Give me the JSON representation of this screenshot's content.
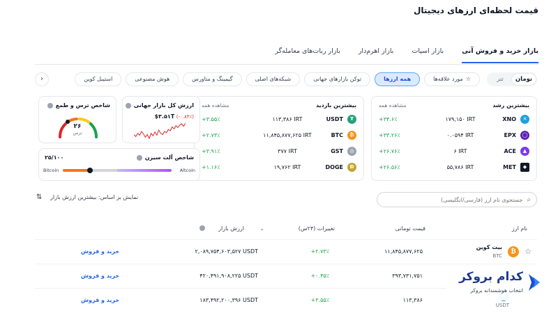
{
  "page_title": "قیمت لحظه‌ای ارزهای دیجیتال",
  "tabs": [
    {
      "label": "بازار خرید و فروش آنی"
    },
    {
      "label": "بازار اسپات"
    },
    {
      "label": "بازار اهرم‌دار"
    },
    {
      "label": "بازار ربات‌های معامله‌گر"
    }
  ],
  "currency_toggle": {
    "toman": "تومان",
    "tether": "تتر"
  },
  "filters": [
    {
      "label": "مورد علاقه‌ها"
    },
    {
      "label": "همه ارزها"
    },
    {
      "label": "توکن بازارهای جهانی"
    },
    {
      "label": "شبکه‌های اصلی"
    },
    {
      "label": "گیمینگ و متاورس"
    },
    {
      "label": "هوش مصنوعی"
    },
    {
      "label": "استیبل کوین"
    }
  ],
  "chevron": "›",
  "top_growth": {
    "title": "بیشترین رشد",
    "more": "مشاهده همه",
    "rows": [
      {
        "symbol": "XNO",
        "price": "۱۷۹,۱۵۰ IRT",
        "change": "+۳۴.۶٪",
        "color": "#1f9fe0"
      },
      {
        "symbol": "EPX",
        "price": "۰.۰۵۹۴ IRT",
        "change": "+۳۳.۲۶٪",
        "color": "#5b21b6"
      },
      {
        "symbol": "ACE",
        "price": "۶ IRT",
        "change": "+۲۶.۷۶٪",
        "color": "#7c3aed"
      },
      {
        "symbol": "MET",
        "price": "۵۵,۷۸۶ IRT",
        "change": "+۲۶.۵۶٪",
        "color": "#111827"
      }
    ]
  },
  "top_visited": {
    "title": "بیشترین بازدید",
    "more": "مشاهده همه",
    "rows": [
      {
        "symbol": "USDT",
        "price": "۱۱۳,۳۸۶ IRT",
        "change": "+۳.۵۵٪",
        "color": "#26a17b"
      },
      {
        "symbol": "BTC",
        "price": "۱۱,۸۴۵,۸۷۷,۶۲۵ IRT",
        "change": "+۲.۷۳٪",
        "color": "#f7931a"
      },
      {
        "symbol": "GST",
        "price": "۳۷۷ IRT",
        "change": "+۳.۹۱٪",
        "color": "#6b7280"
      },
      {
        "symbol": "DOGE",
        "price": "۱۹,۷۶۲ IRT",
        "change": "+۱.۱۶٪",
        "color": "#c2a633"
      }
    ]
  },
  "market_cap": {
    "title": "ارزش کل بازار جهانی",
    "value": "$۳.۵۱T",
    "change": "(-۰.۸۳٪)",
    "sparkline": [
      58,
      55,
      60,
      57,
      63,
      59,
      54,
      58,
      52,
      60,
      56,
      62,
      57,
      65,
      60,
      58,
      63,
      61,
      66,
      64,
      70,
      67,
      72,
      69,
      73,
      75,
      71,
      76
    ]
  },
  "fear_greed": {
    "title": "شاخص ترس و طمع",
    "value": "۲۶",
    "label": "ترس",
    "level": 26
  },
  "altseason": {
    "title": "شاخص آلت سیزن",
    "value": "۲۵/۱۰۰",
    "left": "Bitcoin",
    "right": "Altcoin",
    "level": 25
  },
  "search": {
    "placeholder": "جستجوی نام ارز (فارسی/انگلیسی)"
  },
  "sort": {
    "label": "نمایش بر اساس:  بیشترین ارزش بازار"
  },
  "table": {
    "headers": {
      "name": "نام ارز",
      "price": "قیمت تومانی",
      "change": "تغییرات (۲۴س)",
      "cap": "ارزش بازار"
    },
    "rows": [
      {
        "name": "بیت کوین",
        "symbol": "BTC",
        "price": "۱۱,۸۴۵,۸۷۷,۶۲۵",
        "change": "+۲.۷۳٪",
        "cap": "۲,۰۸۹,۷۵۴,۶۰۳,۵۲۷ USDT",
        "action": "خرید و فروش",
        "color": "#f7931a",
        "glyph": "₿"
      },
      {
        "name": "",
        "symbol": "",
        "price": "۳۹۳,۷۳۱,۷۵۱",
        "change": "+۰.۴۵٪",
        "cap": "۴۲۰,۴۹۱,۹۰۸,۲۲۵ USDT",
        "action": "خرید و فروش",
        "color": "#627eea",
        "glyph": "◆"
      },
      {
        "name": "",
        "symbol": "USDT",
        "price": "۱۱۳,۳۸۶",
        "change": "+۳.۵۵٪",
        "cap": "۱۸۳,۴۹۲,۲۰۰,۳۹۶ USDT",
        "action": "خرید و فروش",
        "color": "#26a17b",
        "glyph": "₮"
      }
    ]
  },
  "brand": {
    "name": "کدام بروکر",
    "tagline": "انتخاب هوشمندانه بروکر",
    "color": "#1f3a8a"
  }
}
